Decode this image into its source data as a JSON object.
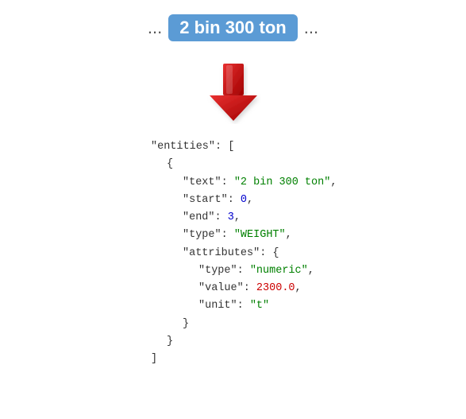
{
  "top": {
    "ellipsis_left": "...",
    "highlight": "2 bin 300 ton",
    "ellipsis_right": "..."
  },
  "json": {
    "entities_key": "\"entities\"",
    "colon_bracket": ": [",
    "open_brace": "{",
    "text_key": "\"text\"",
    "text_val": "\"2 bin 300 ton\"",
    "start_key": "\"start\"",
    "start_val": "0",
    "end_key": "\"end\"",
    "end_val": "3",
    "type_key": "\"type\"",
    "type_val": "\"WEIGHT\"",
    "attributes_key": "\"attributes\"",
    "attributes_open": "{",
    "attr_type_key": "\"type\"",
    "attr_type_val": "\"numeric\"",
    "attr_value_key": "\"value\"",
    "attr_value_val": "2300.0",
    "attr_unit_key": "\"unit\"",
    "attr_unit_val": "\"t\"",
    "close_brace_inner": "}",
    "close_brace_outer": "}",
    "close_bracket": "]"
  }
}
